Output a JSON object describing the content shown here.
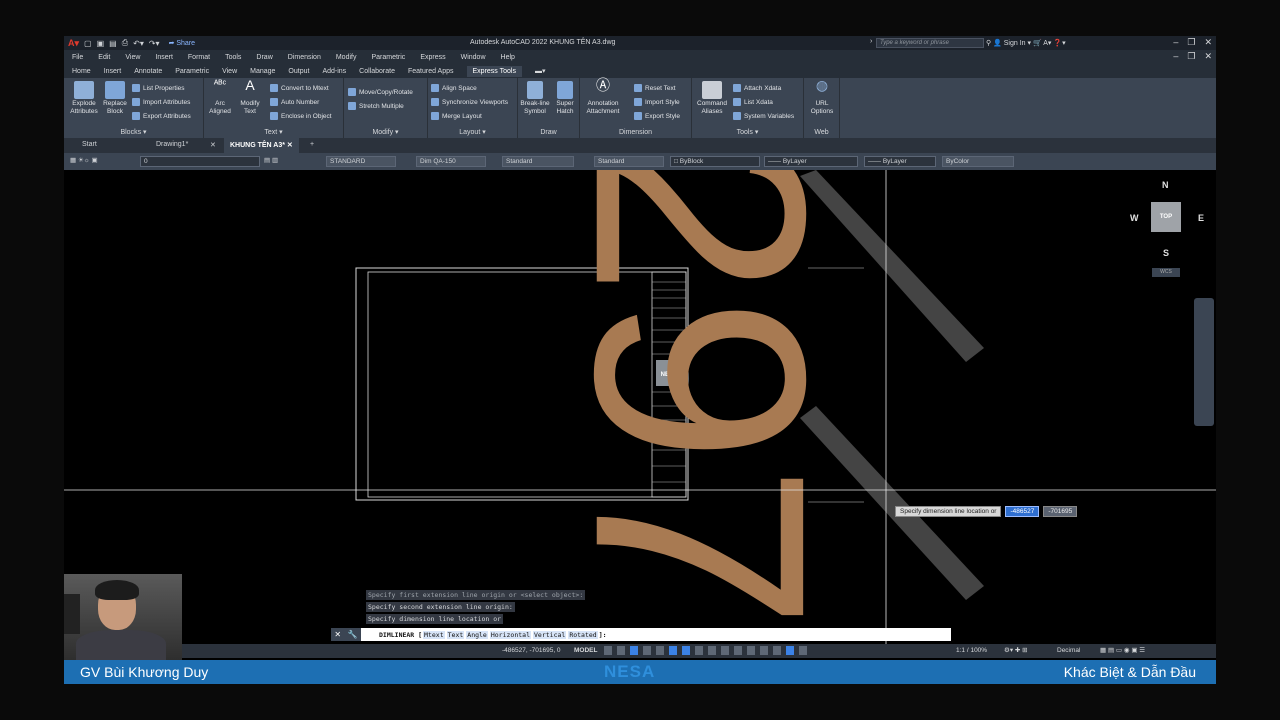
{
  "titlebar": {
    "share": "Share",
    "title": "Autodesk AutoCAD 2022    KHUNG TÊN A3.dwg",
    "search_placeholder": "Type a keyword or phrase",
    "signin": "Sign In"
  },
  "menu": [
    "File",
    "Edit",
    "View",
    "Insert",
    "Format",
    "Tools",
    "Draw",
    "Dimension",
    "Modify",
    "Parametric",
    "Express",
    "Window",
    "Help"
  ],
  "ribbon_tabs": [
    "Home",
    "Insert",
    "Annotate",
    "Parametric",
    "View",
    "Manage",
    "Output",
    "Add-ins",
    "Collaborate",
    "Featured Apps"
  ],
  "ribbon_active_tab": "Express Tools",
  "ribbon": {
    "blocks": {
      "title": "Blocks",
      "explode": "Explode Attributes",
      "replace": "Replace Block",
      "list_props": "List Properties",
      "import_attr": "Import Attributes",
      "export_attr": "Export Attributes"
    },
    "text": {
      "title": "Text",
      "arc": "Arc Aligned",
      "modify_text": "Modify Text",
      "convert": "Convert to Mtext",
      "auto_number": "Auto Number",
      "enclose": "Enclose in Object"
    },
    "modify": {
      "title": "Modify",
      "move": "Move/Copy/Rotate",
      "stretch": "Stretch Multiple"
    },
    "layout": {
      "title": "Layout",
      "align": "Align Space",
      "sync": "Synchronize Viewports",
      "merge": "Merge Layout"
    },
    "draw": {
      "title": "Draw",
      "breakline": "Break-line Symbol",
      "superhatch": "Super Hatch"
    },
    "dimension": {
      "title": "Dimension",
      "annotation": "Annotation Attachment",
      "reset_text": "Reset Text",
      "import_style": "Import Style",
      "export_style": "Export Style"
    },
    "tools": {
      "title": "Tools",
      "command_aliases": "Command Aliases",
      "attach_xdata": "Attach Xdata",
      "list_xdata": "List Xdata",
      "system_vars": "System Variables"
    },
    "web": {
      "title": "Web",
      "url": "URL Options"
    }
  },
  "file_tabs": {
    "start": "Start",
    "drawing1": "Drawing1*",
    "active": "KHUNG TÊN A3*"
  },
  "propbar": {
    "layer": "0",
    "text_style": "STANDARD",
    "dim_style": "Dim QA-150",
    "table_style": "Standard",
    "mleader_style": "Standard",
    "color": "ByBlock",
    "linetype": "ByLayer",
    "lineweight": "ByLayer",
    "plotstyle": "ByColor"
  },
  "viewcube": {
    "n": "N",
    "s": "S",
    "w": "W",
    "e": "E",
    "face": "TOP",
    "wcs": "WCS"
  },
  "canvas": {
    "big_dimension": "297",
    "titleblock_logo": "NESA"
  },
  "tooltip": {
    "label": "Specify dimension line location or",
    "value1": "-486527",
    "value2": "-701695"
  },
  "command_history": [
    "Specify first extension line origin or <select object>:",
    "Specify second extension line origin:",
    "Specify dimension line location or"
  ],
  "command_line": {
    "cmd": "DIMLINEAR [",
    "options": [
      "Mtext",
      "Text",
      "Angle",
      "Horizontal",
      "Vertical",
      "Rotated"
    ],
    "suffix": "]:"
  },
  "status": {
    "coords": "-486527, -701695, 0",
    "space": "MODEL",
    "scale": "1:1 / 100%",
    "units": "Decimal"
  },
  "banner": {
    "left": "GV Bùi Khương Duy",
    "center": "NESA",
    "right": "Khác Biệt & Dẫn Đầu"
  },
  "colors": {
    "dimension_text": "#a87a52",
    "ribbon_bg": "#3b4553",
    "banner": "#1d6fb3"
  }
}
